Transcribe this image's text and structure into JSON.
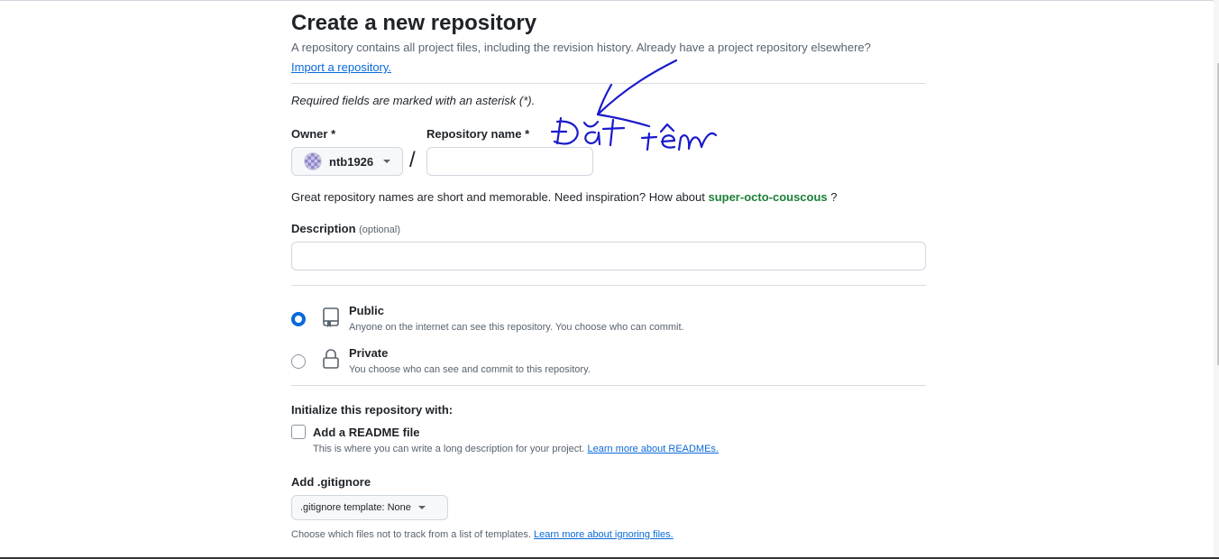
{
  "page": {
    "title": "Create a new repository",
    "subtitle": "A repository contains all project files, including the revision history. Already have a project repository elsewhere?",
    "import_link": "Import a repository.",
    "required_note": "Required fields are marked with an asterisk (*)."
  },
  "owner": {
    "label": "Owner *",
    "value": "ntb1926",
    "icon": "chevron-down-icon"
  },
  "slash": "/",
  "repo_name": {
    "label": "Repository name *",
    "value": "",
    "placeholder": ""
  },
  "hint": {
    "prefix": "Great repository names are short and memorable. Need inspiration? How about ",
    "suggestion": "super-octo-couscous",
    "suffix": " ?"
  },
  "description": {
    "label": "Description",
    "optional": "(optional)",
    "value": ""
  },
  "visibility": {
    "selected": "public",
    "options": [
      {
        "id": "public",
        "title": "Public",
        "desc": "Anyone on the internet can see this repository. You choose who can commit.",
        "icon": "repo-icon"
      },
      {
        "id": "private",
        "title": "Private",
        "desc": "You choose who can see and commit to this repository.",
        "icon": "lock-icon"
      }
    ]
  },
  "init": {
    "label": "Initialize this repository with:",
    "readme_label": "Add a README file",
    "readme_checked": false,
    "readme_desc": "This is where you can write a long description for your project. ",
    "readme_link": "Learn more about READMEs."
  },
  "gitignore": {
    "label": "Add .gitignore",
    "button": ".gitignore template: None",
    "desc": "Choose which files not to track from a list of templates. ",
    "link": "Learn more about ignoring files."
  },
  "annotation": {
    "text": "Đặt tên",
    "color": "#1a1acc"
  },
  "colors": {
    "accent": "#0969da",
    "suggestion": "#1a7f37",
    "muted": "#59636e"
  }
}
